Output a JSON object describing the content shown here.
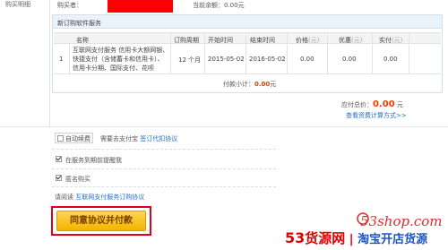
{
  "sidebar": {
    "label": "购买明细"
  },
  "top": {
    "buyer_label": "购买者：",
    "balance_label": "当前余额：",
    "balance_value": "0.00元"
  },
  "panel": {
    "title": "新订购软件服务",
    "columns": {
      "name": "名称",
      "period": "订购周期",
      "start": "开始时间",
      "end": "结束时间",
      "price": "价格",
      "discount": "优惠",
      "paid": "实付",
      "unit": "(元)"
    },
    "row": {
      "index": "1",
      "name_lines": [
        "互联网支付服务 信用卡大额网银、",
        "快捷支付（含储蓄卡和信用卡）、",
        "信用卡分期、国际支付、花呗"
      ],
      "period": "12 个月",
      "start": "2015-05-02",
      "end": "2016-05-02",
      "price": "0.00",
      "discount": "0.00",
      "paid": "0.00"
    },
    "subtotal_label": "付款小计：",
    "subtotal_value": "0.00",
    "subtotal_unit": "元"
  },
  "summary": {
    "total_label": "应付总价：",
    "total_value": "0.00",
    "total_unit": "元",
    "rule_link": "查看资费计算方式>>"
  },
  "options": {
    "auto_renew_label": "自动续费",
    "alipay_note": "需要去支付宝",
    "agent_link": "签订代扣协议",
    "remind_label": "在服务到期前提醒我",
    "anonymous_label": "匿名购买"
  },
  "agreement": {
    "read_prefix": "请阅读",
    "protocol_link": "互联网支付服务订购协议",
    "agree_button": "同意协议并付款"
  },
  "watermark": {
    "url": "53shop.com",
    "brand_digits": "53",
    "brand_goods": "货源网",
    "slogan": "淘宝开店货源"
  },
  "colors": {
    "accent_red": "#f03c00",
    "link_blue": "#1f6fc5",
    "button_yellow": "#f5b400",
    "highlight_red": "#e0001b"
  }
}
